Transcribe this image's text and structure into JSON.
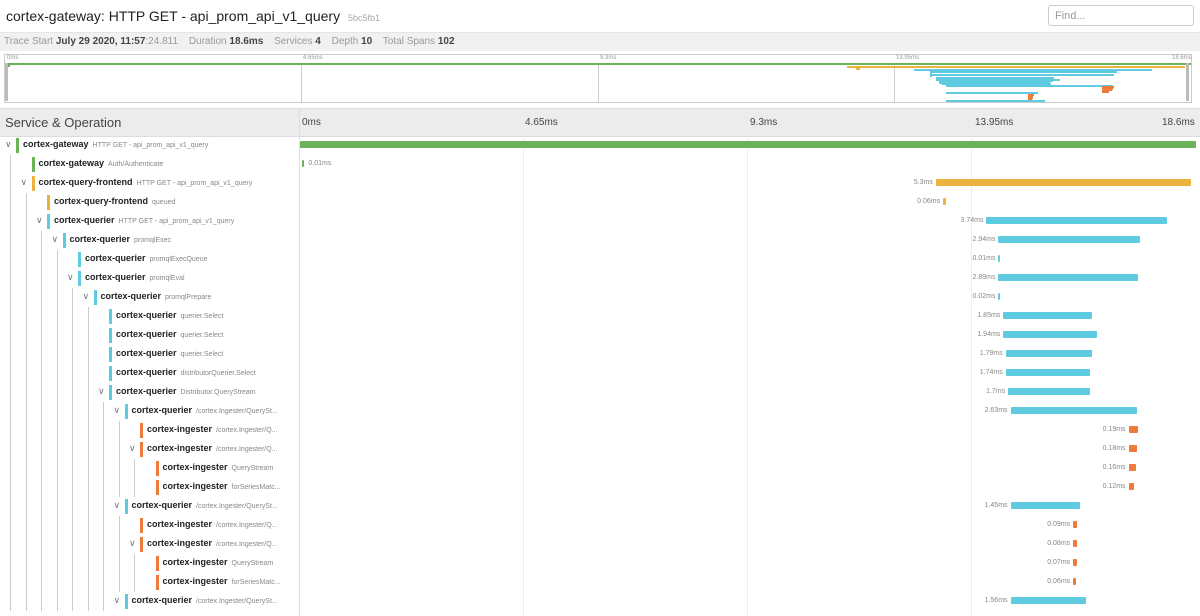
{
  "header": {
    "title": "cortex-gateway: HTTP GET - api_prom_api_v1_query",
    "trace_id": "5bc5fb1",
    "find_placeholder": "Find..."
  },
  "meta": {
    "trace_start_label": "Trace Start",
    "trace_start_value": "July 29 2020, 11:57",
    "trace_start_sec": ":24.811",
    "duration_label": "Duration",
    "duration_value": "18.6ms",
    "services_label": "Services",
    "services_value": "4",
    "depth_label": "Depth",
    "depth_value": "10",
    "spans_label": "Total Spans",
    "spans_value": "102"
  },
  "minimap_ticks": [
    "0ms",
    "4.65ms",
    "9.3ms",
    "13.95ms",
    "18.6ms"
  ],
  "timeline_header": {
    "label": "Service & Operation",
    "ticks": [
      "0ms",
      "4.65ms",
      "9.3ms",
      "13.95ms",
      "18.6ms"
    ]
  },
  "colors": {
    "cortex-gateway": "#6cb25b",
    "cortex-query-frontend": "#eab33d",
    "cortex-querier": "#5ecbe0",
    "cortex-ingester": "#ee7a3c"
  },
  "spans": [
    {
      "service": "cortex-gateway",
      "op": "HTTP GET - api_prom_api_v1_query",
      "depth": 0,
      "toggle": true,
      "start": 0,
      "dur_ms": 18.6,
      "label": ""
    },
    {
      "service": "cortex-gateway",
      "op": "Auth/Authenticate",
      "depth": 1,
      "toggle": false,
      "start": 0.05,
      "dur_ms": 0.01,
      "label": "0.01ms"
    },
    {
      "service": "cortex-query-frontend",
      "op": "HTTP GET - api_prom_api_v1_query",
      "depth": 1,
      "toggle": true,
      "start": 13.2,
      "dur_ms": 5.3,
      "label": "5.3ms"
    },
    {
      "service": "cortex-query-frontend",
      "op": "queued",
      "depth": 2,
      "toggle": false,
      "start": 13.35,
      "dur_ms": 0.06,
      "label": "0.06ms"
    },
    {
      "service": "cortex-querier",
      "op": "HTTP GET - api_prom_api_v1_query",
      "depth": 2,
      "toggle": true,
      "start": 14.25,
      "dur_ms": 3.74,
      "label": "3.74ms"
    },
    {
      "service": "cortex-querier",
      "op": "promqlExec",
      "depth": 3,
      "toggle": true,
      "start": 14.5,
      "dur_ms": 2.94,
      "label": "2.94ms"
    },
    {
      "service": "cortex-querier",
      "op": "promqlExecQueue",
      "depth": 4,
      "toggle": false,
      "start": 14.5,
      "dur_ms": 0.01,
      "label": "0.01ms"
    },
    {
      "service": "cortex-querier",
      "op": "promqlEval",
      "depth": 4,
      "toggle": true,
      "start": 14.5,
      "dur_ms": 2.89,
      "label": "2.89ms"
    },
    {
      "service": "cortex-querier",
      "op": "promqlPrepare",
      "depth": 5,
      "toggle": true,
      "start": 14.5,
      "dur_ms": 0.02,
      "label": "0.02ms"
    },
    {
      "service": "cortex-querier",
      "op": "querier.Select",
      "depth": 6,
      "toggle": false,
      "start": 14.6,
      "dur_ms": 1.85,
      "label": "1.85ms"
    },
    {
      "service": "cortex-querier",
      "op": "querier.Select",
      "depth": 6,
      "toggle": false,
      "start": 14.6,
      "dur_ms": 1.94,
      "label": "1.94ms"
    },
    {
      "service": "cortex-querier",
      "op": "querier.Select",
      "depth": 6,
      "toggle": false,
      "start": 14.65,
      "dur_ms": 1.79,
      "label": "1.79ms"
    },
    {
      "service": "cortex-querier",
      "op": "distributorQuerier.Select",
      "depth": 6,
      "toggle": false,
      "start": 14.65,
      "dur_ms": 1.74,
      "label": "1.74ms"
    },
    {
      "service": "cortex-querier",
      "op": "Distributor.QueryStream",
      "depth": 6,
      "toggle": true,
      "start": 14.7,
      "dur_ms": 1.7,
      "label": "1.7ms"
    },
    {
      "service": "cortex-querier",
      "op": "/cortex.Ingester/QuerySt...",
      "depth": 7,
      "toggle": true,
      "start": 14.75,
      "dur_ms": 2.63,
      "label": "2.63ms"
    },
    {
      "service": "cortex-ingester",
      "op": "/cortex.Ingester/Q...",
      "depth": 8,
      "toggle": false,
      "start": 17.2,
      "dur_ms": 0.19,
      "label": "0.19ms"
    },
    {
      "service": "cortex-ingester",
      "op": "/cortex.Ingester/Q...",
      "depth": 8,
      "toggle": true,
      "start": 17.2,
      "dur_ms": 0.18,
      "label": "0.18ms"
    },
    {
      "service": "cortex-ingester",
      "op": "QueryStream",
      "depth": 9,
      "toggle": false,
      "start": 17.2,
      "dur_ms": 0.16,
      "label": "0.16ms"
    },
    {
      "service": "cortex-ingester",
      "op": "forSeriesMatc...",
      "depth": 9,
      "toggle": false,
      "start": 17.2,
      "dur_ms": 0.12,
      "label": "0.12ms"
    },
    {
      "service": "cortex-querier",
      "op": "/cortex.Ingester/QuerySt...",
      "depth": 7,
      "toggle": true,
      "start": 14.75,
      "dur_ms": 1.45,
      "label": "1.45ms"
    },
    {
      "service": "cortex-ingester",
      "op": "/cortex.Ingester/Q...",
      "depth": 8,
      "toggle": false,
      "start": 16.05,
      "dur_ms": 0.09,
      "label": "0.09ms"
    },
    {
      "service": "cortex-ingester",
      "op": "/cortex.Ingester/Q...",
      "depth": 8,
      "toggle": true,
      "start": 16.05,
      "dur_ms": 0.08,
      "label": "0.08ms"
    },
    {
      "service": "cortex-ingester",
      "op": "QueryStream",
      "depth": 9,
      "toggle": false,
      "start": 16.05,
      "dur_ms": 0.07,
      "label": "0.07ms"
    },
    {
      "service": "cortex-ingester",
      "op": "forSeriesMatc...",
      "depth": 9,
      "toggle": false,
      "start": 16.05,
      "dur_ms": 0.06,
      "label": "0.06ms"
    },
    {
      "service": "cortex-querier",
      "op": "/cortex.Ingester/QuerySt...",
      "depth": 7,
      "toggle": true,
      "start": 14.75,
      "dur_ms": 1.56,
      "label": "1.56ms"
    }
  ]
}
